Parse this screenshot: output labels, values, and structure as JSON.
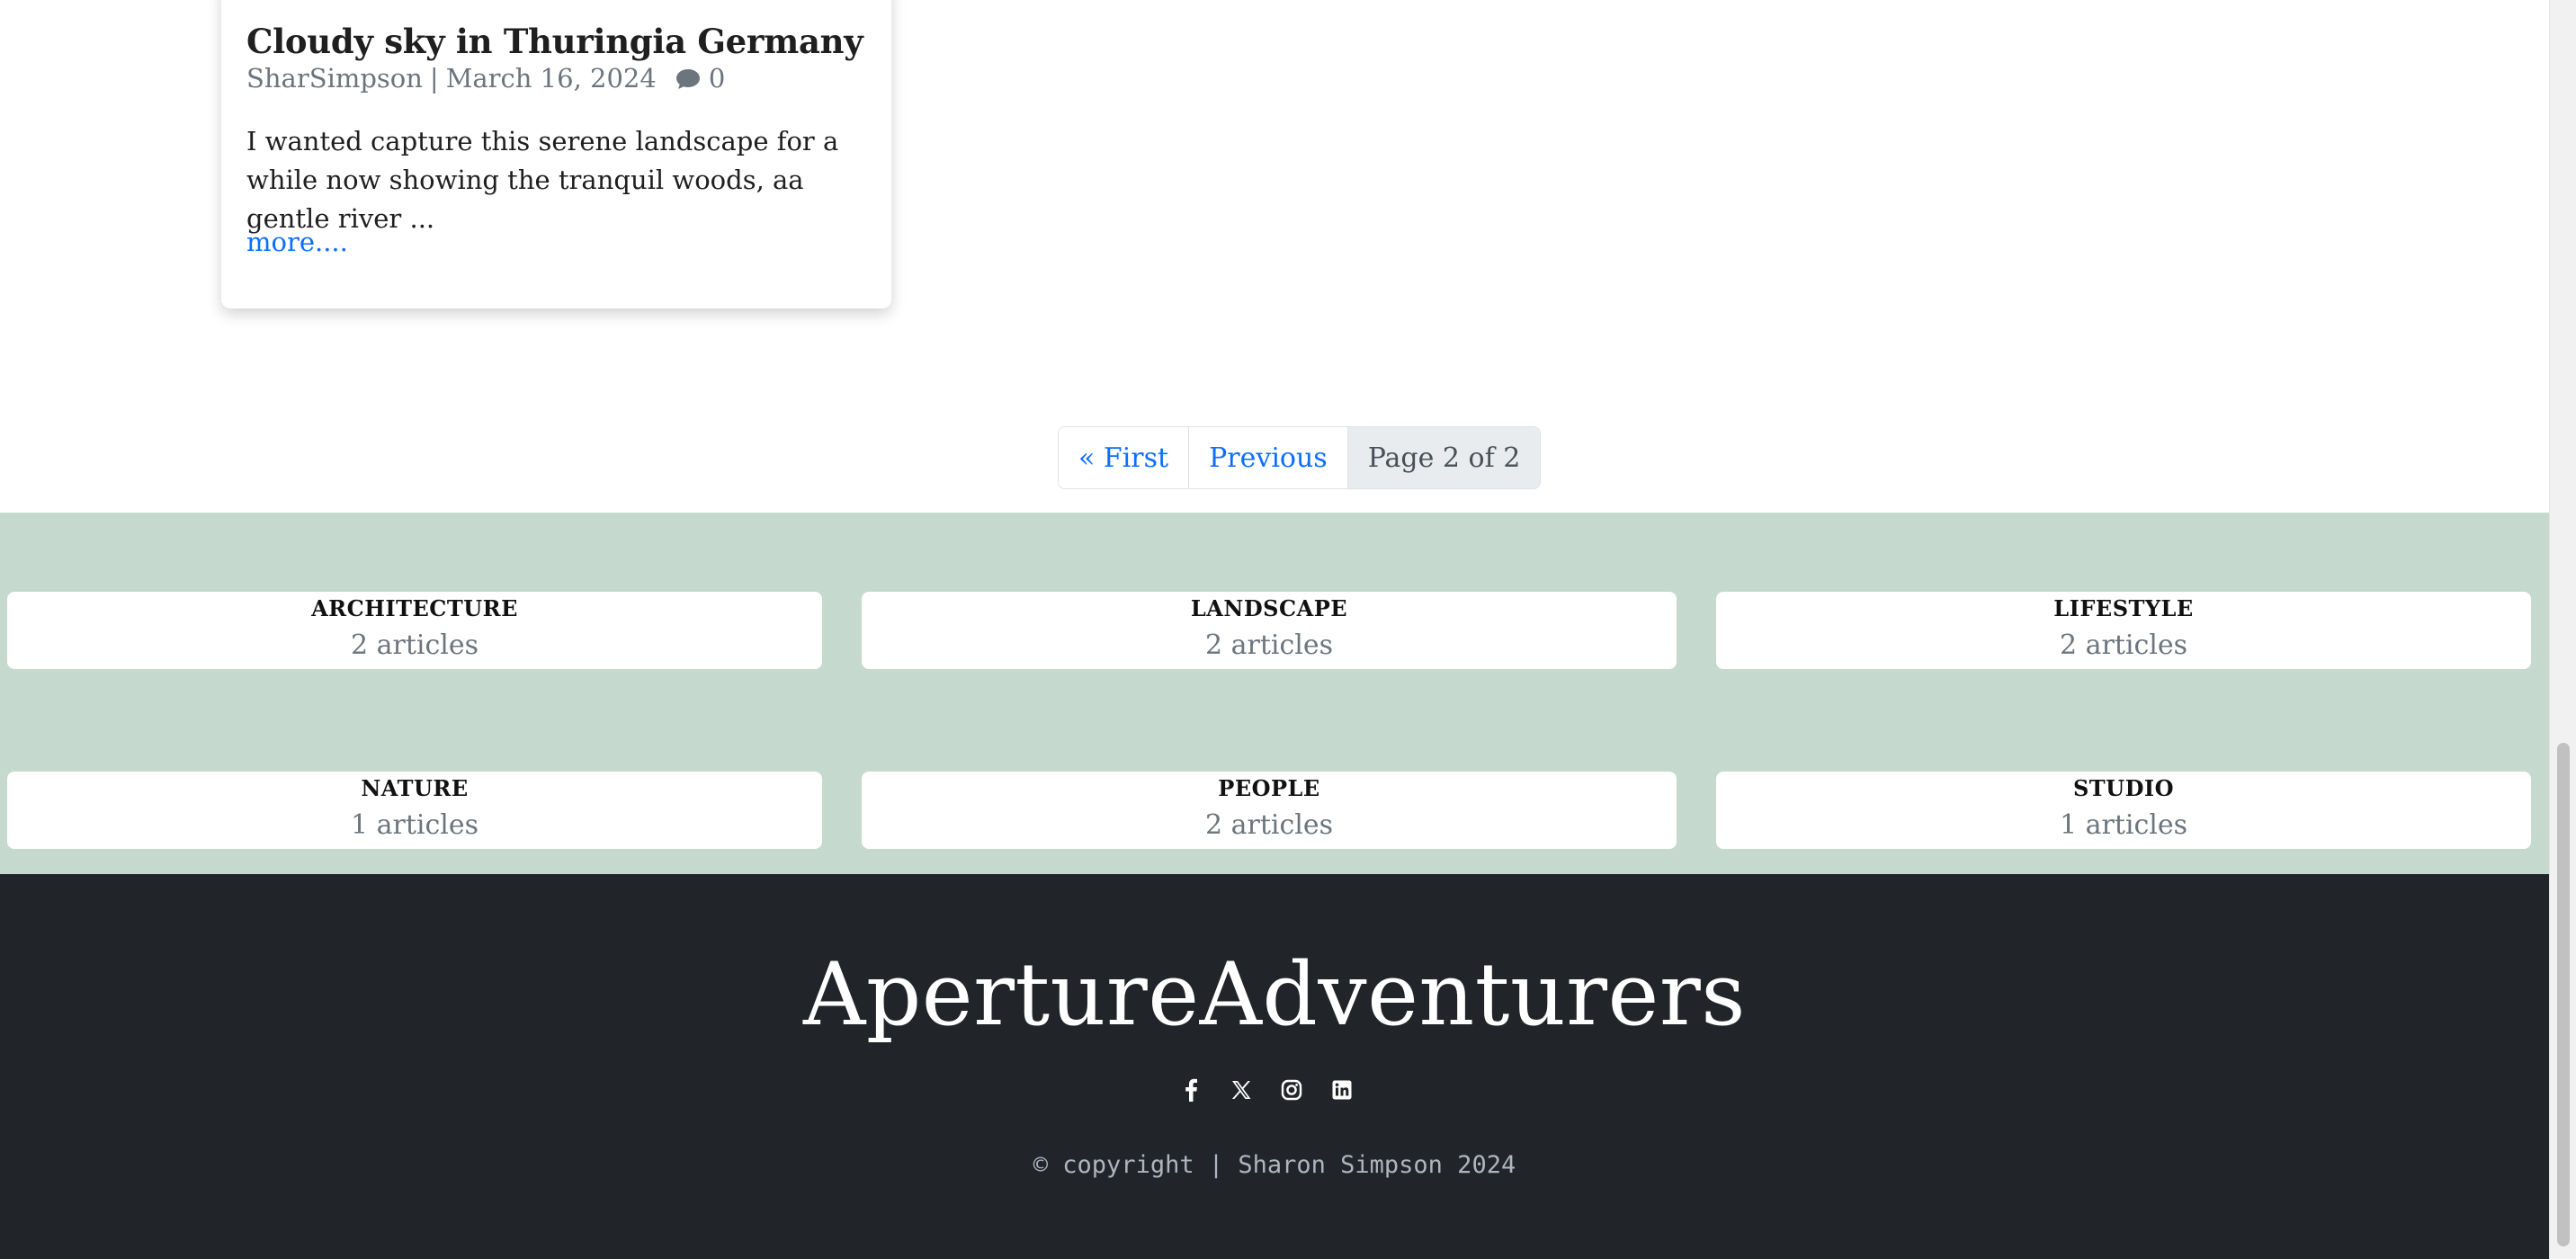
{
  "article": {
    "title": "Cloudy sky in Thuringia Germany",
    "author": "SharSimpson",
    "separator": "|",
    "date": "March 16, 2024",
    "comment_icon": "comment-icon",
    "comment_count": "0",
    "excerpt": "I wanted capture this serene landscape for a while now showing the tranquil woods, aa gentle river ...",
    "more_label": "more...."
  },
  "pagination": {
    "first_label": "« First",
    "previous_label": "Previous",
    "current_label": "Page 2 of 2"
  },
  "categories": [
    {
      "name": "ARCHITECTURE",
      "count": "2 articles"
    },
    {
      "name": "LANDSCAPE",
      "count": "2 articles"
    },
    {
      "name": "LIFESTYLE",
      "count": "2 articles"
    },
    {
      "name": "NATURE",
      "count": "1 articles"
    },
    {
      "name": "PEOPLE",
      "count": "2 articles"
    },
    {
      "name": "STUDIO",
      "count": "1 articles"
    }
  ],
  "footer": {
    "brand": "ApertureAdventurers",
    "social_icons": [
      "facebook-icon",
      "x-twitter-icon",
      "instagram-icon",
      "linkedin-icon"
    ],
    "copyright": "© copyright | Sharon Simpson 2024"
  },
  "colors": {
    "link": "#0d6efd",
    "categories_bg": "#c5d9cf",
    "footer_bg": "#212529"
  }
}
